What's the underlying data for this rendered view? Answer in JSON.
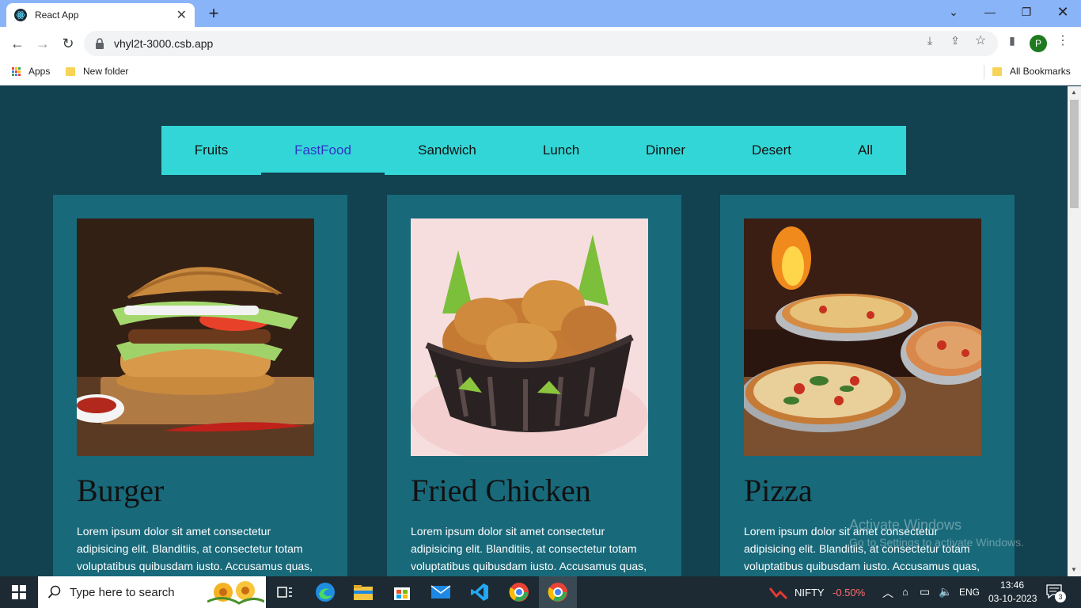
{
  "browser": {
    "tab_title": "React App",
    "url": "vhyl2t-3000.csb.app",
    "bookmarks": {
      "apps_label": "Apps",
      "folder_label": "New folder",
      "all_label": "All Bookmarks"
    },
    "profile_initial": "P"
  },
  "menu": {
    "items": [
      "Fruits",
      "FastFood",
      "Sandwich",
      "Lunch",
      "Dinner",
      "Desert",
      "All"
    ],
    "active": "FastFood"
  },
  "cards": [
    {
      "title": "Burger",
      "description": "Lorem ipsum dolor sit amet consectetur adipisicing elit. Blanditiis, at consectetur totam voluptatibus quibusdam iusto. Accusamus quas,",
      "image_subject": "burger"
    },
    {
      "title": "Fried Chicken",
      "description": "Lorem ipsum dolor sit amet consectetur adipisicing elit. Blanditiis, at consectetur totam voluptatibus quibusdam iusto. Accusamus quas,",
      "image_subject": "fried chicken"
    },
    {
      "title": "Pizza",
      "description": "Lorem ipsum dolor sit amet consectetur adipisicing elit. Blanditiis, at consectetur totam voluptatibus quibusdam iusto. Accusamus quas,",
      "image_subject": "pizza"
    }
  ],
  "watermark": {
    "line1": "Activate Windows",
    "line2": "Go to Settings to activate Windows."
  },
  "taskbar": {
    "search_placeholder": "Type here to search",
    "stock_name": "NIFTY",
    "stock_change": "-0.50%",
    "language": "ENG",
    "time": "13:46",
    "date": "03-10-2023",
    "notification_count": "3"
  },
  "colors": {
    "page_bg": "#12414f",
    "menu_bg": "#33d6d6",
    "card_bg": "#18697a",
    "active_link": "#2f35c8",
    "stock_negative": "#ff6b6b"
  }
}
